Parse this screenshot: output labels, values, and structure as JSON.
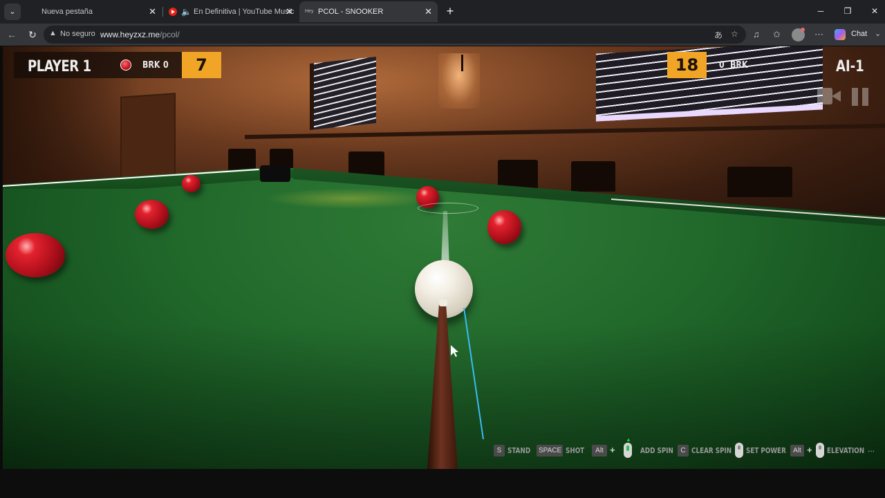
{
  "browser": {
    "tabs": [
      {
        "title": "Nueva pestaña",
        "active": false
      },
      {
        "title": "En Definitiva | YouTube Music",
        "active": false,
        "audio": true
      },
      {
        "title": "PCOL - SNOOKER",
        "active": true,
        "favicon_text": "Hey"
      }
    ],
    "close_glyph": "✕",
    "new_tab_glyph": "+",
    "window_controls": {
      "minimize": "─",
      "maximize": "❐",
      "close": "✕"
    },
    "security_label": "No seguro",
    "url_host": "www.heyzxz.me",
    "url_path": "/pcol/",
    "chat_label": "Chat"
  },
  "hud": {
    "player": {
      "name": "PLAYER 1",
      "break_label": "BRK",
      "break_value": "0",
      "score": "7",
      "target_ball": "red"
    },
    "opponent": {
      "name": "AI-1",
      "break_label": "BRK",
      "break_value": "0",
      "score": "18"
    }
  },
  "controls": [
    {
      "key": "S",
      "label": "STAND"
    },
    {
      "key": "SPACE",
      "label": "SHOT"
    },
    {
      "key": "Alt",
      "label": "ADD SPIN",
      "mouse": "drag"
    },
    {
      "key": "C",
      "label": "CLEAR SPIN"
    },
    {
      "key": "",
      "label": "SET POWER",
      "mouse": "wheel"
    },
    {
      "key": "Alt",
      "label": "ELEVATION",
      "mouse": "wheel"
    }
  ],
  "more_glyph": "...",
  "colors": {
    "score_box": "#f0a527",
    "felt": "#226a2c",
    "red_ball": "#c1121f",
    "cue_ball": "#f4efe4",
    "guide_line": "#38bdf8"
  },
  "icons": [
    "tab-list-icon",
    "youtube-music-icon",
    "speaker-icon",
    "back-icon",
    "reload-icon",
    "warning-icon",
    "translate-icon",
    "star-icon",
    "extensions-icon",
    "favorites-icon",
    "profile-avatar",
    "more-icon",
    "copilot-icon",
    "replay-camera-icon",
    "pause-icon",
    "mouse-icon"
  ]
}
